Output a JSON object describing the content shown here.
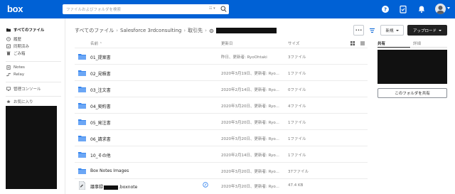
{
  "header": {
    "logo": "box",
    "search_placeholder": "ファイルおよびフォルダを検索",
    "search_options": "☷ ▾",
    "brand_color": "#0061d5"
  },
  "sidebar": {
    "items": [
      {
        "label": "すべてのファイル",
        "icon": "folder-icon"
      },
      {
        "label": "履歴",
        "icon": "clock-icon"
      },
      {
        "label": "同期済み",
        "icon": "sync-icon"
      },
      {
        "label": "ごみ箱",
        "icon": "trash-icon"
      },
      {
        "label": "Notes",
        "icon": "notes-icon"
      },
      {
        "label": "Relay",
        "icon": "relay-icon"
      },
      {
        "label": "管理コンソール",
        "icon": "admin-icon"
      },
      {
        "label": "お気に入り",
        "icon": "star-icon"
      }
    ]
  },
  "breadcrumb": {
    "items": [
      "すべてのファイル",
      "Salesforce 3rdconsulting",
      "取引先"
    ],
    "separator": "›"
  },
  "toolbar": {
    "more_label": "•••",
    "new_label": "新規",
    "upload_label": "アップロード"
  },
  "table": {
    "columns": {
      "name": "名前",
      "updated": "更新日",
      "size": "サイズ"
    },
    "rows": [
      {
        "name": "01_提案書",
        "updated": "昨日、更新者: RyoOhtaki",
        "size": "3ファイル",
        "type": "folder"
      },
      {
        "name": "02_見積書",
        "updated": "2020年3月19日、更新者: Ryo...",
        "size": "1ファイル",
        "type": "folder"
      },
      {
        "name": "03_注文書",
        "updated": "2020年2月14日、更新者: Ryo...",
        "size": "0ファイル",
        "type": "folder"
      },
      {
        "name": "04_契約書",
        "updated": "2020年3月20日、更新者: Ryo...",
        "size": "4ファイル",
        "type": "folder"
      },
      {
        "name": "05_発注書",
        "updated": "2020年3月20日、更新者: Ryo...",
        "size": "1ファイル",
        "type": "folder"
      },
      {
        "name": "06_請求書",
        "updated": "2020年3月20日、更新者: Ryo...",
        "size": "1ファイル",
        "type": "folder"
      },
      {
        "name": "10_その他",
        "updated": "2020年2月14日、更新者: Ryo...",
        "size": "1ファイル",
        "type": "folder"
      },
      {
        "name": "Box Notes Images",
        "updated": "2020年3月20日、更新者: Ryo...",
        "size": "37ファイル",
        "type": "folder"
      },
      {
        "name": "議事録",
        "name_suffix": ".boxnote",
        "updated": "2020年3月20日、更新者: Ryo...",
        "size": "47.4 KB",
        "type": "boxnote"
      }
    ]
  },
  "right_panel": {
    "tab_share": "共有",
    "tab_details": "詳細",
    "share_folder_button": "このフォルダを共有"
  }
}
